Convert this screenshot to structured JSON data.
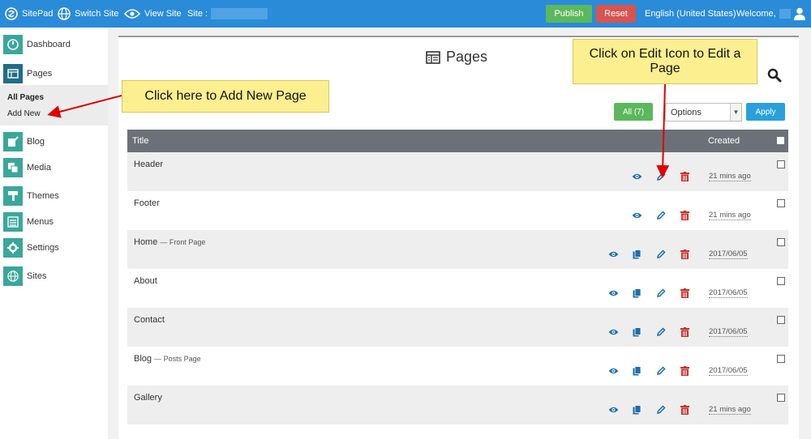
{
  "topbar": {
    "brand": "SitePad",
    "switch_site": "Switch Site",
    "view_site": "View Site",
    "site_label": "Site :",
    "publish": "Publish",
    "reset": "Reset",
    "language": "English (United States)",
    "welcome": "Welcome,"
  },
  "sidebar": {
    "items": [
      {
        "label": "Dashboard",
        "icon": "dashboard-icon"
      },
      {
        "label": "Pages",
        "icon": "pages-icon"
      },
      {
        "label": "Blog",
        "icon": "blog-icon"
      },
      {
        "label": "Media",
        "icon": "media-icon"
      },
      {
        "label": "Themes",
        "icon": "themes-icon"
      },
      {
        "label": "Menus",
        "icon": "menus-icon"
      },
      {
        "label": "Settings",
        "icon": "settings-icon"
      },
      {
        "label": "Sites",
        "icon": "globe-icon"
      }
    ],
    "pages_submenu": {
      "all_pages": "All Pages",
      "add_new": "Add New"
    }
  },
  "main": {
    "title": "Pages",
    "filter_all": "All (7)",
    "bulk_select": "Options",
    "apply": "Apply",
    "columns": {
      "title": "Title",
      "created": "Created"
    },
    "rows": [
      {
        "title": "Header",
        "subtitle": "",
        "created": "21 mins ago"
      },
      {
        "title": "Footer",
        "subtitle": "",
        "created": "21 mins ago"
      },
      {
        "title": "Home",
        "subtitle": "— Front Page",
        "created": "2017/06/05"
      },
      {
        "title": "About",
        "subtitle": "",
        "created": "2017/06/05"
      },
      {
        "title": "Contact",
        "subtitle": "",
        "created": "2017/06/05"
      },
      {
        "title": "Blog",
        "subtitle": "— Posts Page",
        "created": "2017/06/05"
      },
      {
        "title": "Gallery",
        "subtitle": "",
        "created": "21 mins ago"
      }
    ]
  },
  "annotations": {
    "add_new_callout": "Click here to Add New Page",
    "edit_callout": "Click on Edit Icon to Edit a Page"
  },
  "colors": {
    "topbar": "#2a8bd8",
    "publish": "#5cb85c",
    "reset": "#d9534f",
    "sidebar_icon": "#3aa79a",
    "apply": "#29a0dc",
    "table_header": "#6c7179",
    "action_blue": "#1d6fa8",
    "delete_red": "#c9302c",
    "callout": "#fcef90",
    "arrow": "#e00000"
  }
}
